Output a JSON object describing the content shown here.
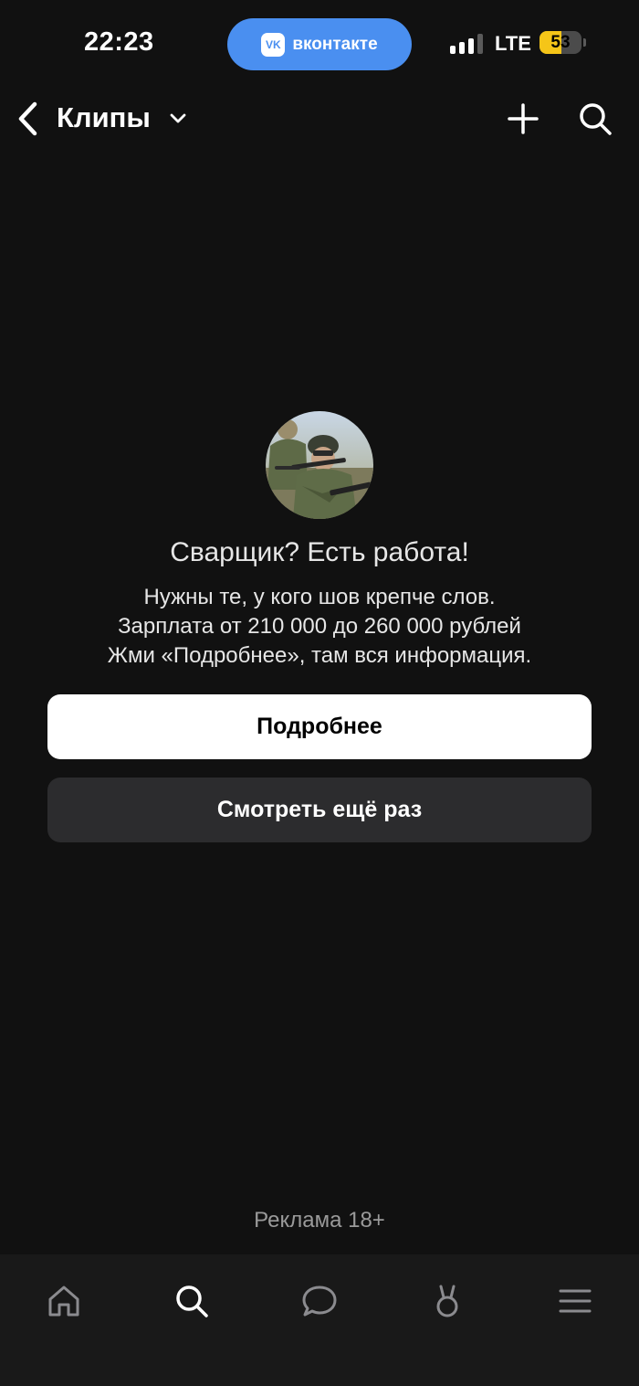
{
  "status_bar": {
    "time": "22:23",
    "app_pill_label": "вконтакте",
    "app_pill_logo": "VK",
    "network": "LTE",
    "battery_percent": 53,
    "battery_label": "53",
    "signal_bars_active": 3,
    "accent_color": "#4a8ff0"
  },
  "header": {
    "title": "Клипы",
    "icons": [
      "back-icon",
      "chevron-down-icon",
      "plus-icon",
      "search-icon"
    ]
  },
  "ad": {
    "avatar_icon": "soldiers-photo",
    "title": "Сварщик? Есть работа!",
    "body_lines": [
      "Нужны те, у кого шов крепче слов.",
      "Зарплата от 210 000 до 260 000 рублей",
      "Жми «Подробнее», там вся информация."
    ],
    "primary_button": "Подробнее",
    "secondary_button": "Смотреть ещё раз",
    "label": "Реклама 18+"
  },
  "tab_bar": {
    "icons": [
      "home-icon",
      "search-icon",
      "messages-icon",
      "clips-icon",
      "menu-icon"
    ],
    "active_index": 1
  }
}
